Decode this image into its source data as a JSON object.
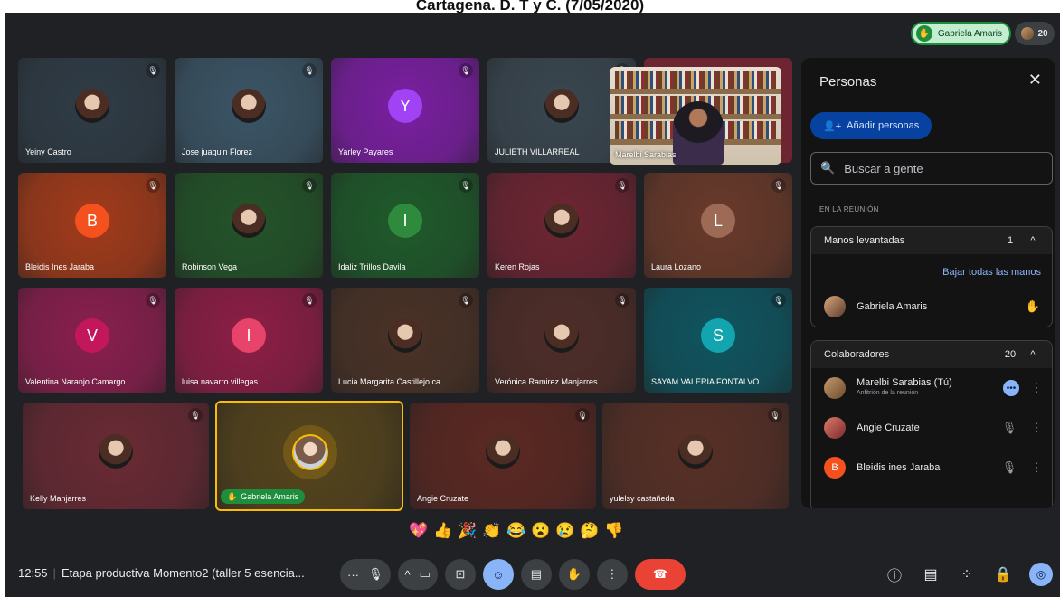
{
  "caption": "Cartagena. D. T y C. (7/05/2020)",
  "top": {
    "raised_hand_name": "Gabriela Amaris",
    "participants_count": "20"
  },
  "tiles": [
    {
      "name": "Yeiny Castro",
      "initial": "",
      "color": "#2f3c46",
      "kind": "photo"
    },
    {
      "name": "Jose juaquin Florez",
      "initial": "",
      "color": "#3b5566",
      "kind": "photo"
    },
    {
      "name": "Yarley Payares",
      "initial": "Y",
      "color": "#7b1fa2",
      "kind": "letter",
      "avatar_color": "#a142f4"
    },
    {
      "name": "JULIETH VILLARREAL",
      "initial": "",
      "color": "#3a4750",
      "kind": "photo"
    },
    {
      "name": "Bleidis Ines Jaraba",
      "initial": "B",
      "color": "#a33b1a",
      "kind": "letter",
      "avatar_color": "#f4511e"
    },
    {
      "name": "Robinson Vega",
      "initial": "",
      "color": "#235428",
      "kind": "photo"
    },
    {
      "name": "Idaliz Trillos Davila",
      "initial": "I",
      "color": "#1f5a2a",
      "kind": "letter",
      "avatar_color": "#2e8b3e"
    },
    {
      "name": "Keren Rojas",
      "initial": "",
      "color": "#6e2532",
      "kind": "photo"
    },
    {
      "name": "Laura Lozano",
      "initial": "L",
      "color": "#6a3a2a",
      "kind": "letter",
      "avatar_color": "#9c6a55"
    },
    {
      "name": "Valentina Naranjo Camargo",
      "initial": "V",
      "color": "#8a1f4e",
      "kind": "letter",
      "avatar_color": "#c2185b"
    },
    {
      "name": "luisa navarro villegas",
      "initial": "I",
      "color": "#8e1e46",
      "kind": "letter",
      "avatar_color": "#e8436a"
    },
    {
      "name": "Lucia Margarita Castillejo ca...",
      "initial": "",
      "color": "#4a3226",
      "kind": "photo"
    },
    {
      "name": "Verónica Ramirez Manjarres",
      "initial": "",
      "color": "#4f2d28",
      "kind": "photo"
    },
    {
      "name": "SAYAM VALERIA FONTALVO",
      "initial": "S",
      "color": "#0f5560",
      "kind": "letter",
      "avatar_color": "#12a4af"
    },
    {
      "name": "Kelly Manjarres",
      "initial": "",
      "color": "#6a2a34",
      "kind": "photo"
    },
    {
      "name": "Gabriela Amaris",
      "initial": "",
      "color": "#56451c",
      "kind": "self"
    },
    {
      "name": "Angie Cruzate",
      "initial": "",
      "color": "#5c2822",
      "kind": "photo"
    },
    {
      "name": "yulelsy castañeda",
      "initial": "",
      "color": "#583026",
      "kind": "photo"
    }
  ],
  "presenter": {
    "name": "Marelbi Sarabias"
  },
  "reactions": [
    "💖",
    "👍",
    "🎉",
    "👏",
    "😂",
    "😮",
    "😢",
    "🤔",
    "👎"
  ],
  "bottom": {
    "time": "12:55",
    "meeting_title": "Etapa productiva Momento2 (taller 5 esencia..."
  },
  "panel": {
    "title": "Personas",
    "add_label": "Añadir personas",
    "search_placeholder": "Buscar a gente",
    "section_label": "EN LA REUNIÓN",
    "raised": {
      "label": "Manos levantadas",
      "count": "1",
      "lower_all": "Bajar todas las manos",
      "people": [
        {
          "name": "Gabriela Amaris"
        }
      ]
    },
    "collaborators": {
      "label": "Colaboradores",
      "count": "20",
      "people": [
        {
          "name": "Marelbi Sarabias (Tú)",
          "sub": "Anfitrión de la reunión",
          "initial": "",
          "color": "#8d6e63"
        },
        {
          "name": "Angie Cruzate",
          "sub": "",
          "initial": "",
          "color": "#c0504a"
        },
        {
          "name": "Bleidis ines Jaraba",
          "sub": "",
          "initial": "B",
          "color": "#f4511e"
        }
      ]
    }
  }
}
